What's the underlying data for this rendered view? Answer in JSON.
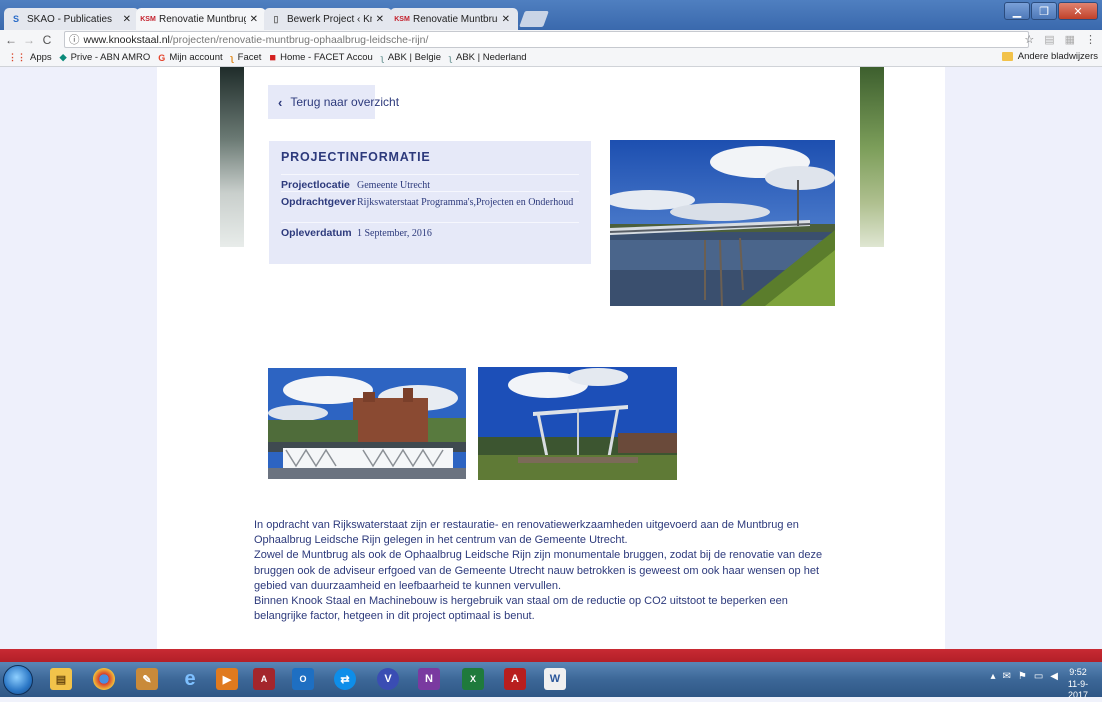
{
  "browser": {
    "tabs": [
      {
        "label": "SKAO - Publicaties",
        "icon": "skao-s-icon",
        "active": false
      },
      {
        "label": "Renovatie Muntbrug en",
        "icon": "knook-logo-icon",
        "active": true
      },
      {
        "label": "Bewerk Project ‹ Knook",
        "icon": "document-icon",
        "active": false
      },
      {
        "label": "Renovatie Muntbrug en",
        "icon": "knook-logo-icon",
        "active": false
      }
    ],
    "url_host": "www.knookstaal.nl",
    "url_path": "/projecten/renovatie-muntbrug-ophaalbrug-leidsche-rijn/",
    "bookmarks": [
      "Apps",
      "Prive - ABN AMRO",
      "Mijn account",
      "Facet",
      "Home - FACET Accou",
      "ABK | Belgie",
      "ABK | Nederland"
    ],
    "other_bookmarks": "Andere bladwijzers"
  },
  "page": {
    "back_label": "Terug naar overzicht",
    "info_title": "PROJECTINFORMATIE",
    "info_rows": [
      {
        "key": "Projectlocatie",
        "value": "Gemeente Utrecht"
      },
      {
        "key": "Opdrachtgever",
        "value": "Rijkswaterstaat Programma's,Projecten en Onderhoud"
      },
      {
        "key": "Opleverdatum",
        "value": "1 September, 2016"
      }
    ],
    "description": [
      "In opdracht van Rijkswaterstaat zijn er restauratie- en  renovatiewerkzaamheden uitgevoerd aan de Muntbrug en Ophaalbrug Leidsche Rijn gelegen in het centrum van de Gemeente Utrecht.",
      "Zowel de Muntbrug als ook de Ophaalbrug Leidsche Rijn zijn monumentale bruggen, zodat bij de renovatie van deze bruggen ook de adviseur erfgoed van de Gemeente Utrecht nauw betrokken is geweest om ook haar wensen op het gebied van duurzaamheid en leefbaarheid te kunnen vervullen.",
      "Binnen Knook Staal en Machinebouw is hergebruik van staal om de reductie op CO2 uitstoot te beperken een belangrijke factor, hetgeen in dit project optimaal is benut."
    ]
  },
  "taskbar": {
    "apps": [
      "firefox-icon",
      "explorer-icon",
      "chrome-icon",
      "paint-icon",
      "ie-icon",
      "media-icon",
      "access-icon",
      "outlook-icon",
      "teamviewer-icon",
      "visio-icon",
      "onenote-icon",
      "excel-icon",
      "acrobat-icon",
      "word-icon"
    ],
    "time": "9:52",
    "date": "11-9-2017"
  }
}
